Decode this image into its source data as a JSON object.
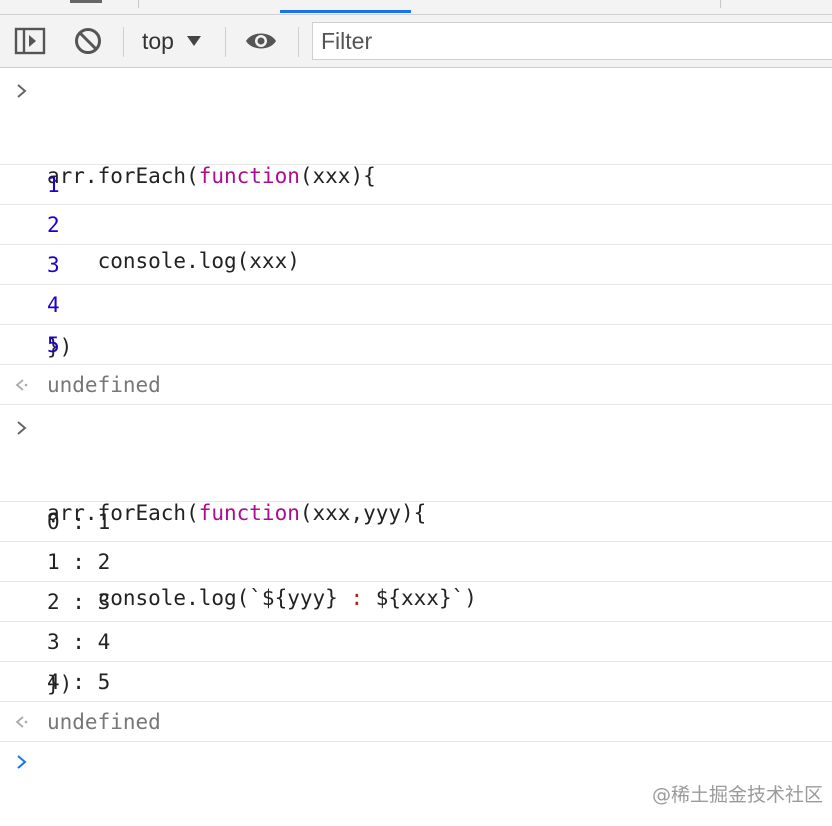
{
  "toolbar": {
    "context_label": "top",
    "filter_placeholder": "Filter"
  },
  "entries": {
    "cmd1": {
      "l1_a": "arr.forEach(",
      "l1_kw": "function",
      "l1_b": "(xxx){",
      "l2": "    console.log(xxx)",
      "l3": "})"
    },
    "out1": [
      "1",
      "2",
      "3",
      "4",
      "5"
    ],
    "ret1": "undefined",
    "cmd2": {
      "l1_a": "arr.forEach(",
      "l1_kw": "function",
      "l1_b": "(xxx,yyy){",
      "l2_a": "    console.log(`${yyy}",
      "l2_str": " : ",
      "l2_b": "${xxx}`)",
      "l3": "})"
    },
    "out2": [
      "0 : 1",
      "1 : 2",
      "2 : 3",
      "3 : 4",
      "4 : 5"
    ],
    "ret2": "undefined"
  },
  "watermark": "@稀土掘金技术社区",
  "colors": {
    "keyword": "#aa0d91",
    "number": "#1c00cf",
    "string": "#c41a16",
    "prompt_accent": "#1a73e8"
  },
  "icons": {
    "sidebar": "sidebar-toggle-icon",
    "clear": "clear-console-icon",
    "dropdown": "triangle-down-icon",
    "live": "eye-icon",
    "input_prompt": "chevron-right-icon",
    "result_prompt": "return-arrow-icon"
  }
}
